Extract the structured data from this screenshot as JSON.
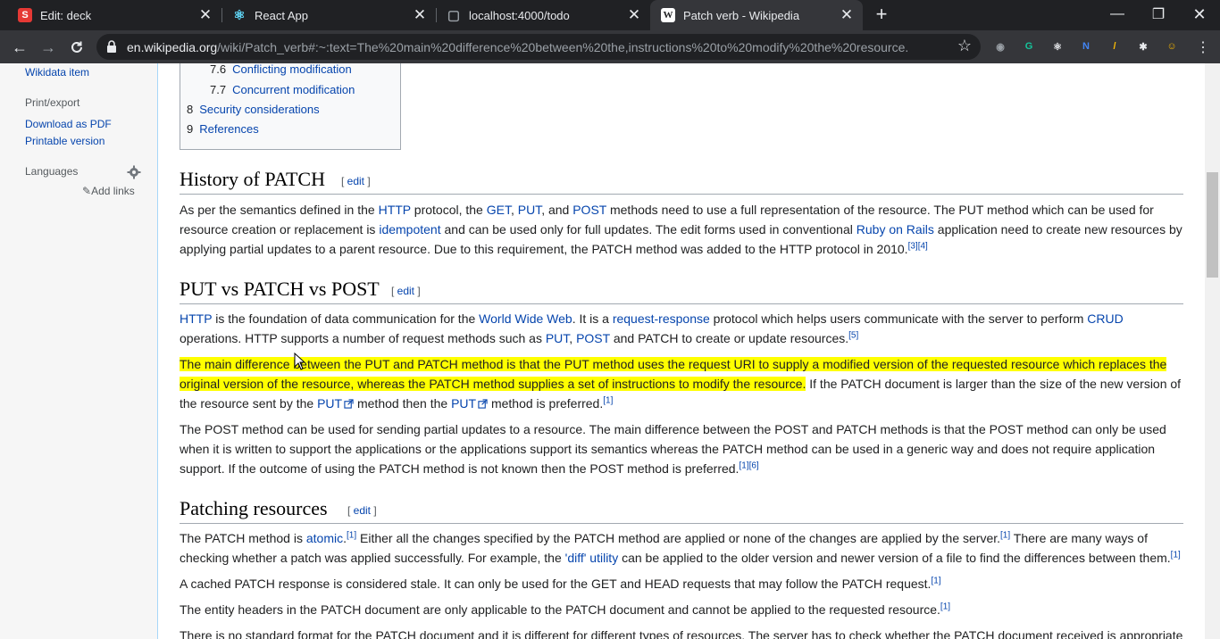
{
  "browser": {
    "tabs": [
      {
        "title": "Edit: deck",
        "favicon_text": "S",
        "favicon_color": "#e53935"
      },
      {
        "title": "React App",
        "favicon_text": "⚛",
        "favicon_color": "#61dafb"
      },
      {
        "title": "localhost:4000/todo",
        "favicon_text": "▢",
        "favicon_color": "#9aa0a6"
      },
      {
        "title": "Patch verb - Wikipedia",
        "favicon_text": "W",
        "favicon_color": "#ffffff",
        "active": true
      }
    ],
    "url_host": "en.wikipedia.org",
    "url_path": "/wiki/Patch_verb#:~:text=The%20main%20difference%20between%20the,instructions%20to%20modify%20the%20resource.",
    "extensions": [
      {
        "name": "record-icon",
        "glyph": "◉",
        "color": "#9aa0a6"
      },
      {
        "name": "grammarly-icon",
        "glyph": "G",
        "color": "#15c39a"
      },
      {
        "name": "react-devtools-icon",
        "glyph": "⚛",
        "color": "#e8eaed"
      },
      {
        "name": "notion-icon",
        "glyph": "N",
        "color": "#4285f4"
      },
      {
        "name": "pencil-icon",
        "glyph": "/",
        "color": "#fbbc04"
      },
      {
        "name": "extensions-puzzle-icon",
        "glyph": "✱",
        "color": "#e8eaed"
      },
      {
        "name": "profile-avatar-icon",
        "glyph": "☺",
        "color": "#f4b400"
      }
    ]
  },
  "sidebar": {
    "wikidata": "Wikidata item",
    "print_head": "Print/export",
    "download_pdf": "Download as PDF",
    "printable": "Printable version",
    "languages": "Languages",
    "add_links": "Add links"
  },
  "toc": [
    {
      "num": "7.6",
      "text": "Conflicting modification"
    },
    {
      "num": "7.7",
      "text": "Concurrent modification"
    },
    {
      "num": "8",
      "text": "Security considerations"
    },
    {
      "num": "9",
      "text": "References"
    }
  ],
  "edit_label": "edit",
  "sections": {
    "history": {
      "heading": "History of PATCH",
      "p1": {
        "t1": "As per the semantics defined in the ",
        "l1": "HTTP",
        "t2": " protocol, the ",
        "l2": "GET",
        "t3": ", ",
        "l3": "PUT",
        "t4": ", and ",
        "l4": "POST",
        "t5": " methods need to use a full representation of the resource. The PUT method which can be used for resource creation or replacement is ",
        "l5": "idempotent",
        "t6": " and can be used only for full updates. The edit forms used in conventional ",
        "l6": "Ruby on Rails",
        "t7": " application need to create new resources by applying partial updates to a parent resource. Due to this requirement, the PATCH method was added to the HTTP protocol in 2010.",
        "sup": "[3][4]"
      }
    },
    "putvs": {
      "heading": "PUT vs PATCH vs POST",
      "p1": {
        "l1": "HTTP",
        "t1": " is the foundation of data communication for the ",
        "l2": "World Wide Web",
        "t2": ". It is a ",
        "l3": "request-response",
        "t3": " protocol which helps users communicate with the server to perform ",
        "l4": "CRUD",
        "t4": " operations. HTTP supports a number of request methods such as ",
        "l5": "PUT",
        "t5": ", ",
        "l6": "POST",
        "t6": " and PATCH to create or update resources.",
        "sup": "[5]"
      },
      "p2": {
        "highlight": "The main difference between the PUT and PATCH method is that the PUT method uses the request URI to supply a modified version of the requested resource which replaces the original version of the resource, whereas the PATCH method supplies a set of instructions to modify the resource.",
        "t1": " If the PATCH document is larger than the size of the new version of the resource sent by the ",
        "l1": "PUT",
        "t2": " method then the ",
        "l2": "PUT",
        "t3": " method is preferred.",
        "sup": "[1]"
      },
      "p3": {
        "t1": "The POST method can be used for sending partial updates to a resource. The main difference between the POST and PATCH methods is that the POST method can only be used when it is written to support the applications or the applications support its semantics whereas the PATCH method can be used in a generic way and does not require application support. If the outcome of using the PATCH method is not known then the POST method is preferred.",
        "sup": "[1][6]"
      }
    },
    "patching": {
      "heading": "Patching resources",
      "p1": {
        "t1": "The PATCH method is ",
        "l1": "atomic",
        "t2": ".",
        "sup1": "[1]",
        "t3": " Either all the changes specified by the PATCH method are applied or none of the changes are applied by the server.",
        "sup2": "[1]",
        "t4": " There are many ways of checking whether a patch was applied successfully. For example, the ",
        "l2": "'diff' utility",
        "t5": " can be applied to the older version and newer version of a file to find the differences between them.",
        "sup3": "[1]"
      },
      "p2": {
        "t1": "A cached PATCH response is considered stale. It can only be used for the GET and HEAD requests that may follow the PATCH request.",
        "sup": "[1]"
      },
      "p3": {
        "t1": "The entity headers in the PATCH document are only applicable to the PATCH document and cannot be applied to the requested resource.",
        "sup": "[1]"
      },
      "p4": {
        "t1": "There is no standard format for the PATCH document and it is different for different types of resources. The server has to check whether the PATCH document received is appropriate"
      }
    }
  }
}
